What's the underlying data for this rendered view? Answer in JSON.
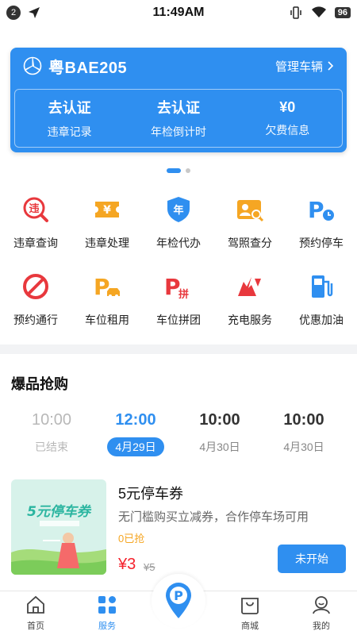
{
  "status_bar": {
    "notification_count": "2",
    "time": "11:49AM",
    "battery": "96"
  },
  "vehicle": {
    "plate": "粤BAE205",
    "manage_label": "管理车辆",
    "stats": [
      {
        "value": "去认证",
        "label": "违章记录"
      },
      {
        "value": "去认证",
        "label": "年检倒计时"
      },
      {
        "value": "¥0",
        "label": "欠费信息"
      }
    ]
  },
  "services": [
    {
      "label": "违章查询",
      "icon": "violation-query-icon",
      "color": "#e8383d"
    },
    {
      "label": "违章处理",
      "icon": "violation-handle-icon",
      "color": "#f5a623"
    },
    {
      "label": "年检代办",
      "icon": "annual-inspection-icon",
      "color": "#2f8ff0"
    },
    {
      "label": "驾照查分",
      "icon": "license-score-icon",
      "color": "#f5a623"
    },
    {
      "label": "预约停车",
      "icon": "reserve-parking-icon",
      "color": "#2f8ff0"
    },
    {
      "label": "预约通行",
      "icon": "reserve-pass-icon",
      "color": "#e8383d"
    },
    {
      "label": "车位租用",
      "icon": "space-rent-icon",
      "color": "#f5a623"
    },
    {
      "label": "车位拼团",
      "icon": "space-group-icon",
      "color": "#e8383d"
    },
    {
      "label": "充电服务",
      "icon": "charging-icon",
      "color": "#e8383d"
    },
    {
      "label": "优惠加油",
      "icon": "fuel-icon",
      "color": "#2f8ff0"
    }
  ],
  "section_title": "爆品抢购",
  "time_slots": [
    {
      "time": "10:00",
      "date": "已结束",
      "state": "ended"
    },
    {
      "time": "12:00",
      "date": "4月29日",
      "state": "active"
    },
    {
      "time": "10:00",
      "date": "4月30日",
      "state": "upcoming"
    },
    {
      "time": "10:00",
      "date": "4月30日",
      "state": "upcoming"
    }
  ],
  "product": {
    "image_text": "5元停车券",
    "name": "5元停车券",
    "description": "无门槛购买立减券，合作停车场可用",
    "sold": "0已抢",
    "price": "¥3",
    "original_price": "¥5",
    "button": "未开始"
  },
  "bottom_nav": [
    {
      "label": "首页",
      "icon": "home-icon"
    },
    {
      "label": "服务",
      "icon": "services-icon"
    },
    {
      "label": "",
      "icon": "parking-icon"
    },
    {
      "label": "商城",
      "icon": "mall-icon"
    },
    {
      "label": "我的",
      "icon": "profile-icon"
    }
  ],
  "colors": {
    "accent": "#2f8ff0",
    "price": "#f5222d",
    "warning": "#f5a623"
  }
}
